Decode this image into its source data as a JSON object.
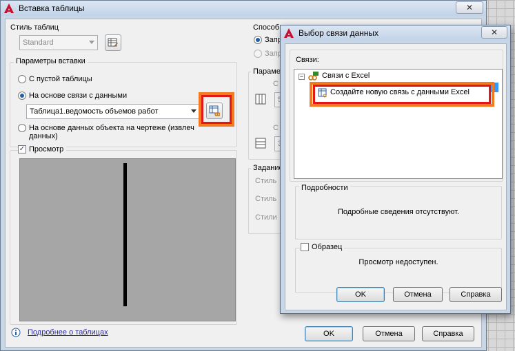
{
  "main_dialog": {
    "title": "Вставка таблицы",
    "close_glyph": "✕",
    "table_style": {
      "label": "Стиль таблиц",
      "value": "Standard"
    },
    "insert_options": {
      "label": "Параметры вставки",
      "option_empty": "С пустой таблицы",
      "option_data_link": "На основе связи с данными",
      "data_link_value": "Таблица1.ведомость объемов работ",
      "option_drawing_line1": "На основе данных объекта на чертеже (извлеч",
      "option_drawing_line2": "данных)"
    },
    "preview": {
      "label": "Просмотр",
      "checked": true
    },
    "insertion_method": {
      "label": "Способ вставки",
      "option1": "Запр",
      "option2": "Запр"
    },
    "column_row_settings": {
      "label": "Парамет",
      "c1": "С",
      "c2": "5",
      "c3": "С",
      "c4": "3"
    },
    "cell_styles": {
      "label": "Задание",
      "s1": "Стиль",
      "s2": "Стиль",
      "s3": "Стили"
    },
    "more_link": "Подробнее о таблицах",
    "ok": "OK",
    "cancel": "Отмена",
    "help": "Справка"
  },
  "data_link_dialog": {
    "title": "Выбор связи данных",
    "close_glyph": "✕",
    "links_label": "Связи:",
    "tree_root": "Связи с Excel",
    "tree_new_link": "Создайте новую связь с данными Excel",
    "details_label": "Подробности",
    "details_text": "Подробные сведения отсутствуют.",
    "sample_label": "Образец",
    "sample_text": "Просмотр недоступен.",
    "ok": "OK",
    "cancel": "Отмена",
    "help": "Справка"
  },
  "colors": {
    "highlight_orange": "#f47a20",
    "highlight_red": "#e01818",
    "selection_blue": "#3399ff"
  }
}
